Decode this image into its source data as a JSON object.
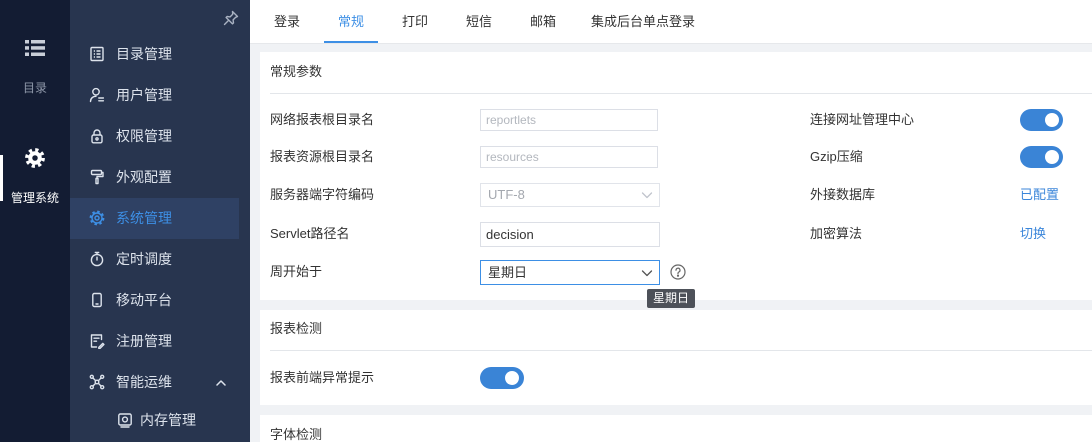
{
  "rail": {
    "catalog": {
      "label": "目录",
      "icon": "list-icon"
    },
    "system": {
      "label": "管理系统",
      "icon": "gear-icon",
      "active": true
    }
  },
  "sidebar": {
    "pin_icon": "pin-icon",
    "items": [
      {
        "label": "目录管理",
        "icon": "catalog-icon"
      },
      {
        "label": "用户管理",
        "icon": "user-icon"
      },
      {
        "label": "权限管理",
        "icon": "lock-icon"
      },
      {
        "label": "外观配置",
        "icon": "paint-roller-icon"
      },
      {
        "label": "系统管理",
        "icon": "gear-icon",
        "active": true
      },
      {
        "label": "定时调度",
        "icon": "timer-icon"
      },
      {
        "label": "移动平台",
        "icon": "mobile-icon"
      },
      {
        "label": "注册管理",
        "icon": "register-icon"
      },
      {
        "label": "智能运维",
        "icon": "network-icon",
        "expanded": true
      }
    ],
    "sub_items": [
      {
        "label": "内存管理",
        "icon": "memory-icon"
      }
    ]
  },
  "tabs": [
    {
      "label": "登录"
    },
    {
      "label": "常规",
      "active": true
    },
    {
      "label": "打印"
    },
    {
      "label": "短信"
    },
    {
      "label": "邮箱"
    },
    {
      "label": "集成后台单点登录"
    }
  ],
  "general": {
    "title": "常规参数",
    "report_root": {
      "label": "网络报表根目录名",
      "value": "reportlets",
      "readonly": true
    },
    "resource_root": {
      "label": "报表资源根目录名",
      "value": "resources",
      "readonly": true
    },
    "server_encoding": {
      "label": "服务器端字符编码",
      "value": "UTF-8",
      "disabled": true
    },
    "servlet_path": {
      "label": "Servlet路径名",
      "value": "decision"
    },
    "week_start": {
      "label": "周开始于",
      "value": "星期日",
      "help_icon": "question-circle-icon",
      "tooltip": "星期日"
    },
    "connect_center": {
      "label": "连接网址管理中心",
      "enabled": true
    },
    "gzip": {
      "label": "Gzip压缩",
      "enabled": true
    },
    "external_db": {
      "label": "外接数据库",
      "link": "已配置"
    },
    "encryption": {
      "label": "加密算法",
      "link": "切换"
    }
  },
  "report_check": {
    "title": "报表检测",
    "frontend_alert": {
      "label": "报表前端异常提示",
      "enabled": true
    }
  },
  "font_check": {
    "title": "字体检测"
  },
  "colors": {
    "accent": "#3d8fe5",
    "toggle_on": "#3a84d6",
    "link": "#3b86da",
    "rail_bg": "#131c33",
    "sidebar_bg": "#28354f",
    "sidebar_active_bg": "#2f4164",
    "page_bg": "#f0f2f5",
    "tooltip_bg": "#4d5159"
  }
}
